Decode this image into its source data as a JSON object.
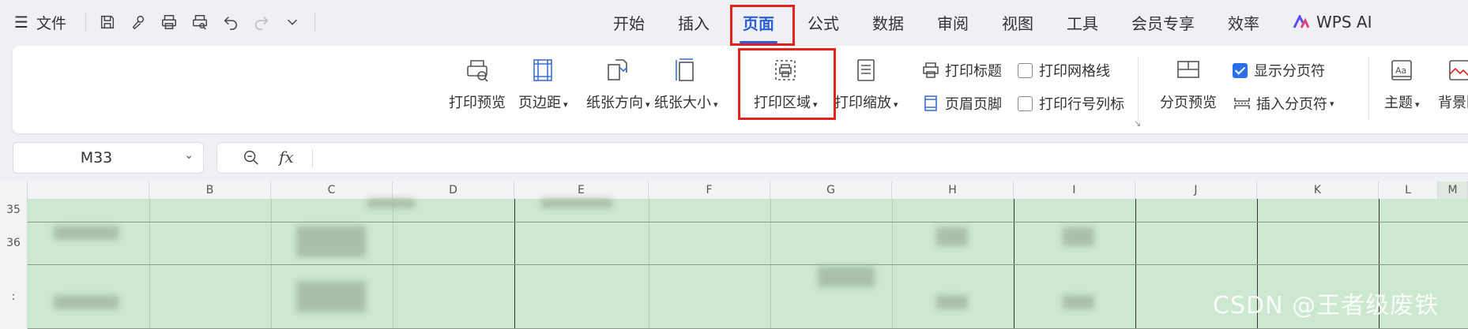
{
  "quick_bar": {
    "menu_label": "文件",
    "icons": [
      "save-icon",
      "format-painter-icon",
      "print-icon",
      "print-preview-icon",
      "undo-icon",
      "redo-icon",
      "more-chevron-icon"
    ]
  },
  "tabs": [
    {
      "label": "开始"
    },
    {
      "label": "插入"
    },
    {
      "label": "页面",
      "active": true
    },
    {
      "label": "公式"
    },
    {
      "label": "数据"
    },
    {
      "label": "审阅"
    },
    {
      "label": "视图"
    },
    {
      "label": "工具"
    },
    {
      "label": "会员专享"
    },
    {
      "label": "效率"
    },
    {
      "label": "WPS AI"
    }
  ],
  "ribbon": {
    "print_preview": "打印预览",
    "margins": "页边距",
    "orientation": "纸张方向",
    "paper_size": "纸张大小",
    "print_area": "打印区域",
    "print_scale": "打印缩放",
    "print_titles": "打印标题",
    "header_footer": "页眉页脚",
    "print_gridlines": "打印网格线",
    "print_row_col_headers": "打印行号列标",
    "page_break_preview": "分页预览",
    "show_page_breaks": "显示分页符",
    "insert_page_break": "插入分页符",
    "theme": "主题",
    "background": "背景图"
  },
  "checkboxes": {
    "print_gridlines": false,
    "print_row_col_headers": false,
    "show_page_breaks": true
  },
  "formula_bar": {
    "name_box": "M33",
    "fx_label": "fx",
    "formula": ""
  },
  "columns": [
    "B",
    "C",
    "D",
    "E",
    "F",
    "G",
    "H",
    "I",
    "J",
    "K",
    "L",
    "M"
  ],
  "rows": [
    "35",
    "36",
    ":"
  ],
  "watermark": "CSDN @王者级废铁",
  "colors": {
    "accent": "#2a5fd8",
    "highlight": "#e3231e",
    "cell_fill": "#cde8d0"
  }
}
